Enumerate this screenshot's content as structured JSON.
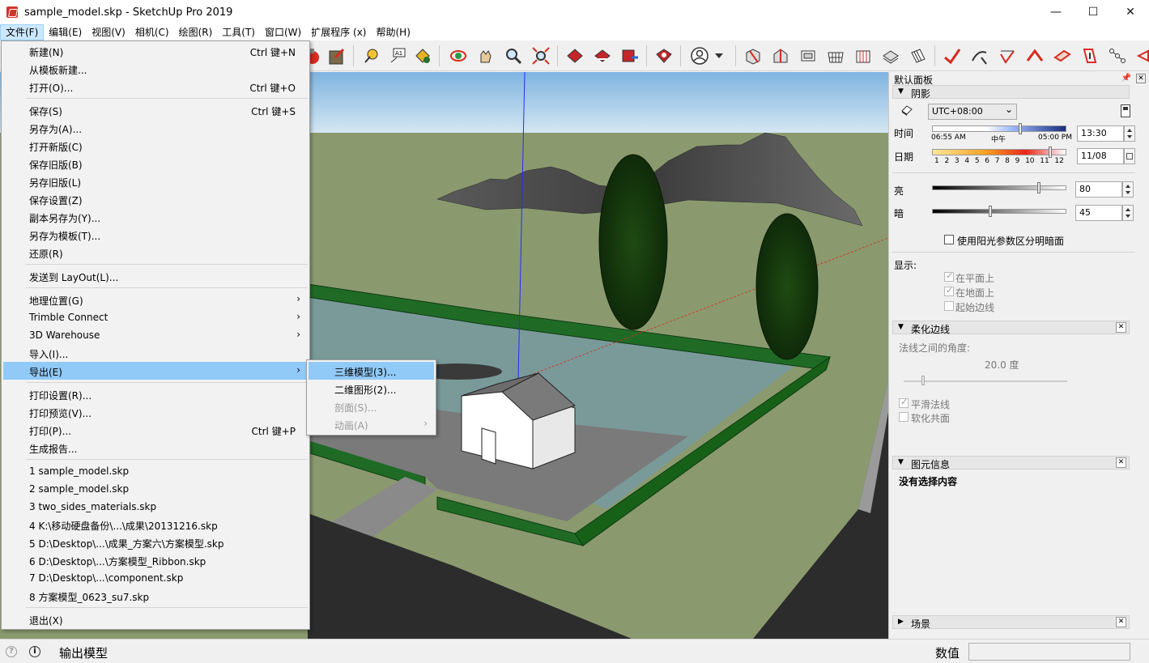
{
  "window": {
    "title": "sample_model.skp - SketchUp Pro 2019",
    "minimize": "—",
    "maximize": "☐",
    "close": "✕"
  },
  "menubar": [
    "文件(F)",
    "编辑(E)",
    "视图(V)",
    "相机(C)",
    "绘图(R)",
    "工具(T)",
    "窗口(W)",
    "扩展程序 (x)",
    "帮助(H)"
  ],
  "file_menu": {
    "items": [
      {
        "label": "新建(N)",
        "shortcut": "Ctrl 键+N"
      },
      {
        "label": "从模板新建...",
        "shortcut": ""
      },
      {
        "label": "打开(O)...",
        "shortcut": "Ctrl 键+O"
      },
      {
        "label": "保存(S)",
        "shortcut": "Ctrl 键+S"
      },
      {
        "label": "另存为(A)...",
        "shortcut": ""
      },
      {
        "label": "打开新版(C)",
        "shortcut": ""
      },
      {
        "label": "保存旧版(B)",
        "shortcut": ""
      },
      {
        "label": "另存旧版(L)",
        "shortcut": ""
      },
      {
        "label": "保存设置(Z)",
        "shortcut": ""
      },
      {
        "label": "副本另存为(Y)...",
        "shortcut": ""
      },
      {
        "label": "另存为模板(T)...",
        "shortcut": ""
      },
      {
        "label": "还原(R)",
        "shortcut": ""
      },
      {
        "label": "发送到 LayOut(L)...",
        "shortcut": ""
      },
      {
        "label": "地理位置(G)",
        "shortcut": ""
      },
      {
        "label": "Trimble Connect",
        "shortcut": ""
      },
      {
        "label": "3D Warehouse",
        "shortcut": ""
      },
      {
        "label": "导入(I)...",
        "shortcut": ""
      },
      {
        "label": "导出(E)",
        "shortcut": ""
      },
      {
        "label": "打印设置(R)...",
        "shortcut": ""
      },
      {
        "label": "打印预览(V)...",
        "shortcut": ""
      },
      {
        "label": "打印(P)...",
        "shortcut": "Ctrl 键+P"
      },
      {
        "label": "生成报告...",
        "shortcut": ""
      },
      {
        "label": "1 sample_model.skp",
        "shortcut": ""
      },
      {
        "label": "2 sample_model.skp",
        "shortcut": ""
      },
      {
        "label": "3 two_sides_materials.skp",
        "shortcut": ""
      },
      {
        "label": "4 K:\\移动硬盘备份\\...\\成果\\20131216.skp",
        "shortcut": ""
      },
      {
        "label": "5 D:\\Desktop\\...\\成果_方案六\\方案模型.skp",
        "shortcut": ""
      },
      {
        "label": "6 D:\\Desktop\\...\\方案模型_Ribbon.skp",
        "shortcut": ""
      },
      {
        "label": "7 D:\\Desktop\\...\\component.skp",
        "shortcut": ""
      },
      {
        "label": "8 方案模型_0623_su7.skp",
        "shortcut": ""
      },
      {
        "label": "退出(X)",
        "shortcut": ""
      }
    ]
  },
  "export_submenu": [
    "三维模型(3)...",
    "二维图形(2)...",
    "剖面(S)...",
    "动画(A)"
  ],
  "tray": {
    "title": "默认面板",
    "shadows": {
      "title": "阴影",
      "timezone": "UTC+08:00",
      "time_label": "时间",
      "date_label": "日期",
      "time_start": "06:55 AM",
      "time_mid": "中午",
      "time_end": "05:00 PM",
      "time_value": "13:30",
      "date_value": "11/08",
      "months": [
        "1",
        "2",
        "3",
        "4",
        "5",
        "6",
        "7",
        "8",
        "9",
        "10",
        "11",
        "12"
      ],
      "light_label": "亮",
      "dark_label": "暗",
      "light_value": "80",
      "dark_value": "45",
      "use_sun_label": "使用阳光参数区分明暗面",
      "display_label": "显示:",
      "on_faces": "在平面上",
      "on_ground": "在地面上",
      "from_edges": "起始边线"
    },
    "soften": {
      "title": "柔化边线",
      "angle_label": "法线之间的角度:",
      "angle_value": "20.0  度",
      "smooth_normals": "平滑法线",
      "soften_coplanar": "软化共面"
    },
    "entity_info": {
      "title": "图元信息",
      "no_selection": "没有选择内容"
    },
    "scenes": {
      "title": "场景"
    }
  },
  "status": {
    "text": "输出模型",
    "measure_label": "数值",
    "measure_value": ""
  }
}
